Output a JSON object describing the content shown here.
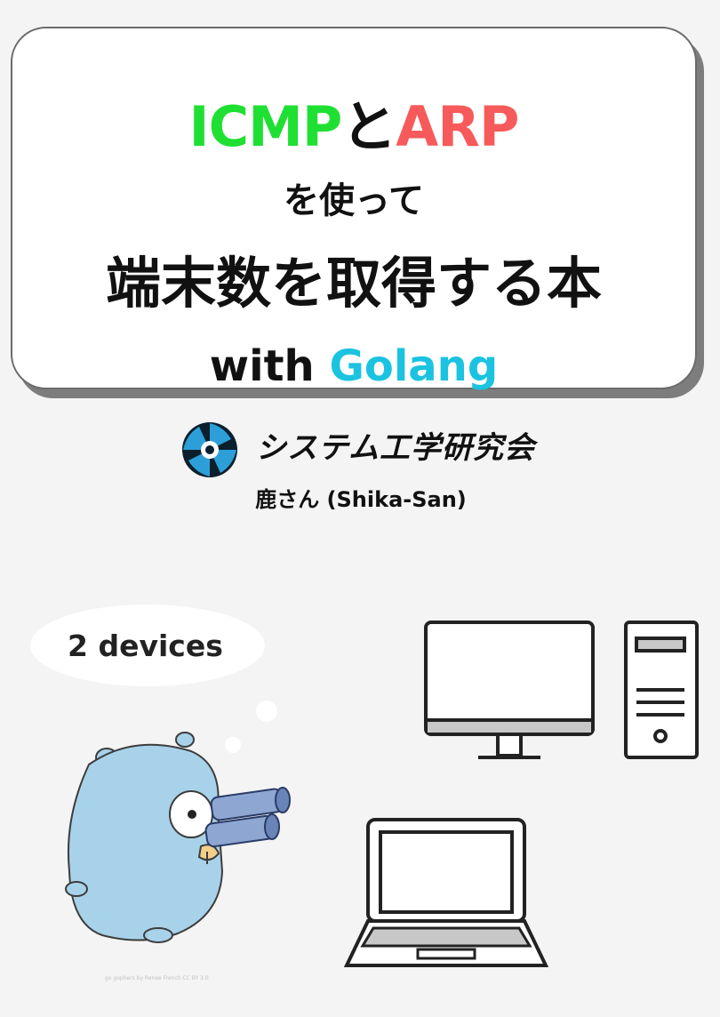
{
  "title": {
    "icmp": "ICMP",
    "to": "と",
    "arp": "ARP",
    "line2": "を使って",
    "line3": "端末数を取得する本",
    "with": "with",
    "golang": "Golang"
  },
  "organization": "システム工学研究会",
  "author": "鹿さん (Shika-San)",
  "thought_bubble": "2 devices",
  "credit": "go gophers by Renee French CC BY 3.0",
  "colors": {
    "icmp": "#1fe032",
    "arp": "#f75a5a",
    "golang": "#1bc3e0",
    "gopher": "#a8d2ea",
    "binoculars": "#8ea6d2"
  },
  "icons": [
    "gopher-mascot",
    "binoculars-icon",
    "desktop-monitor-icon",
    "tower-pc-icon",
    "laptop-icon",
    "org-logo-icon"
  ]
}
